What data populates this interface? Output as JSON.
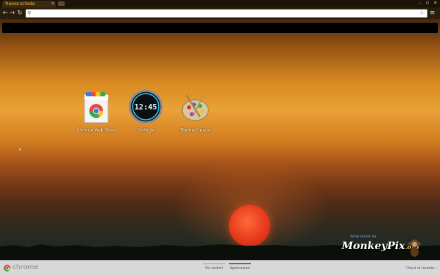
{
  "tab": {
    "title": "Nuova scheda",
    "close": "×"
  },
  "window_controls": [
    "–",
    "▫",
    "×"
  ],
  "toolbar": {
    "back": "←",
    "forward": "→",
    "reload": "↻",
    "omnibox_value": "",
    "menu": "≡"
  },
  "apps": [
    {
      "label": "Chrome Web Store",
      "icon": "chrome-web-store-icon"
    },
    {
      "label": "Orologio",
      "icon": "clock-icon",
      "time": "12:45"
    },
    {
      "label": "Theme Creator",
      "icon": "theme-creator-palette-icon"
    }
  ],
  "nav_left_arrow": "‹",
  "theme_credit": {
    "caption": "Tema creato da",
    "logo_text": "MonkeyPix",
    "logo_suffix": ".org"
  },
  "footer": {
    "brand": "chrome",
    "tabs": [
      {
        "label": "Più visitati",
        "active": false
      },
      {
        "label": "Applicazioni",
        "active": true
      }
    ],
    "recently_closed": "Chiusi di recente"
  },
  "colors": {
    "accent": "#f0c040",
    "sun": "#e83a1c",
    "footer_bg": "#d8d8d8"
  }
}
